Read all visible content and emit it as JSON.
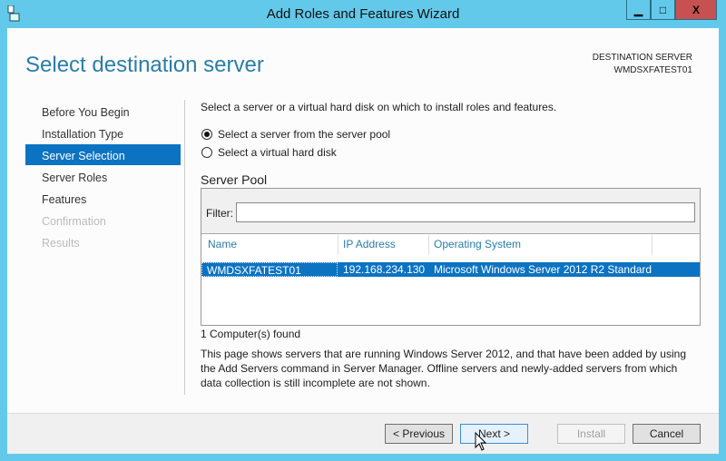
{
  "window": {
    "title": "Add Roles and Features Wizard",
    "minimize": "▁",
    "maximize": "□",
    "close": "X"
  },
  "header": {
    "title": "Select destination server",
    "dest_label": "DESTINATION SERVER",
    "dest_server": "WMDSXFATEST01"
  },
  "nav": [
    {
      "label": "Before You Begin",
      "state": "normal"
    },
    {
      "label": "Installation Type",
      "state": "normal"
    },
    {
      "label": "Server Selection",
      "state": "selected"
    },
    {
      "label": "Server Roles",
      "state": "normal"
    },
    {
      "label": "Features",
      "state": "normal"
    },
    {
      "label": "Confirmation",
      "state": "disabled"
    },
    {
      "label": "Results",
      "state": "disabled"
    }
  ],
  "main": {
    "intro": "Select a server or a virtual hard disk on which to install roles and features.",
    "radio_pool": "Select a server from the server pool",
    "radio_vhd": "Select a virtual hard disk",
    "pool_title": "Server Pool",
    "filter_label": "Filter:",
    "filter_value": "",
    "columns": [
      "Name",
      "IP Address",
      "Operating System"
    ],
    "rows": [
      {
        "name": "WMDSXFATEST01",
        "ip": "192.168.234.130",
        "os": "Microsoft Windows Server 2012 R2 Standard"
      }
    ],
    "count": "1 Computer(s) found",
    "note": "This page shows servers that are running Windows Server 2012, and that have been added by using the Add Servers command in Server Manager. Offline servers and newly-added servers from which data collection is still incomplete are not shown."
  },
  "buttons": {
    "previous": "< Previous",
    "next": "Next >",
    "install": "Install",
    "cancel": "Cancel"
  }
}
